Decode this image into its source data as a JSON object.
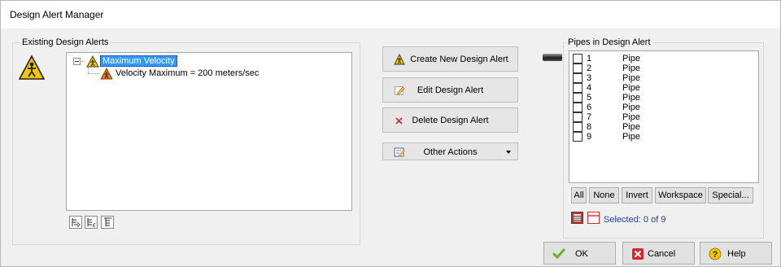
{
  "window": {
    "title": "Design Alert Manager"
  },
  "existing_alerts": {
    "group_label": "Existing Design Alerts",
    "tree": {
      "root": {
        "label": "Maximum Velocity",
        "selected": true,
        "expanded": true
      },
      "children": [
        {
          "label": "Velocity Maximum = 200 meters/sec"
        }
      ]
    },
    "tree_buttons": [
      {
        "icon": "expand-tree-icon"
      },
      {
        "icon": "collapse-tree-icon"
      },
      {
        "icon": "tree-options-icon"
      }
    ]
  },
  "actions": {
    "create_label": "Create New Design Alert",
    "edit_label": "Edit Design Alert",
    "delete_label": "Delete Design Alert",
    "other_label": "Other Actions"
  },
  "pipes": {
    "group_label": "Pipes in Design Alert",
    "rows": [
      {
        "num": "1",
        "type": "Pipe",
        "checked": false
      },
      {
        "num": "2",
        "type": "Pipe",
        "checked": false
      },
      {
        "num": "3",
        "type": "Pipe",
        "checked": false
      },
      {
        "num": "4",
        "type": "Pipe",
        "checked": false
      },
      {
        "num": "5",
        "type": "Pipe",
        "checked": false
      },
      {
        "num": "6",
        "type": "Pipe",
        "checked": false
      },
      {
        "num": "7",
        "type": "Pipe",
        "checked": false
      },
      {
        "num": "8",
        "type": "Pipe",
        "checked": false
      },
      {
        "num": "9",
        "type": "Pipe",
        "checked": false
      }
    ],
    "select_buttons": {
      "all": "All",
      "none": "None",
      "invert": "Invert",
      "workspace": "Workspace",
      "special": "Special..."
    },
    "selected_text": "Selected: 0 of 9"
  },
  "dialog_buttons": {
    "ok": "OK",
    "cancel": "Cancel",
    "help": "Help"
  },
  "colors": {
    "accent_blue": "#3399ff",
    "warning_yellow": "#f5c400",
    "warning_orange": "#e87722",
    "cancel_red": "#d9272e",
    "ok_green": "#6ab023",
    "selected_text_blue": "#1a3cb4"
  }
}
